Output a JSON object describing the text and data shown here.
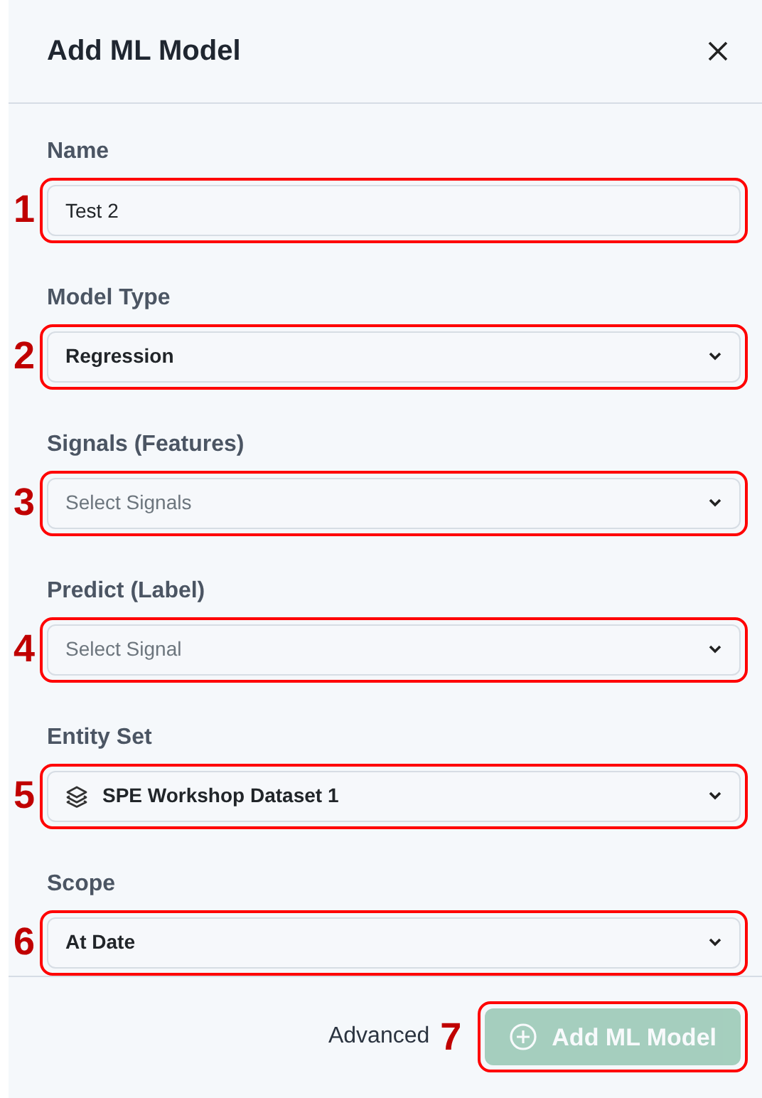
{
  "dialog": {
    "title": "Add ML Model"
  },
  "fields": [
    {
      "label": "Name",
      "kind": "text",
      "value": "Test 2",
      "callout": "1"
    },
    {
      "label": "Model Type",
      "kind": "select",
      "value": "Regression",
      "callout": "2"
    },
    {
      "label": "Signals (Features)",
      "kind": "select",
      "placeholder": "Select Signals",
      "callout": "3"
    },
    {
      "label": "Predict (Label)",
      "kind": "select",
      "placeholder": "Select Signal",
      "callout": "4"
    },
    {
      "label": "Entity Set",
      "kind": "iconselect",
      "value": "SPE Workshop Dataset 1",
      "callout": "5"
    },
    {
      "label": "Scope",
      "kind": "select",
      "value": "At Date",
      "callout": "6"
    }
  ],
  "footer": {
    "advanced": "Advanced",
    "callout": "7",
    "submit": {
      "label": "Add ML Model",
      "disabled": true
    }
  }
}
